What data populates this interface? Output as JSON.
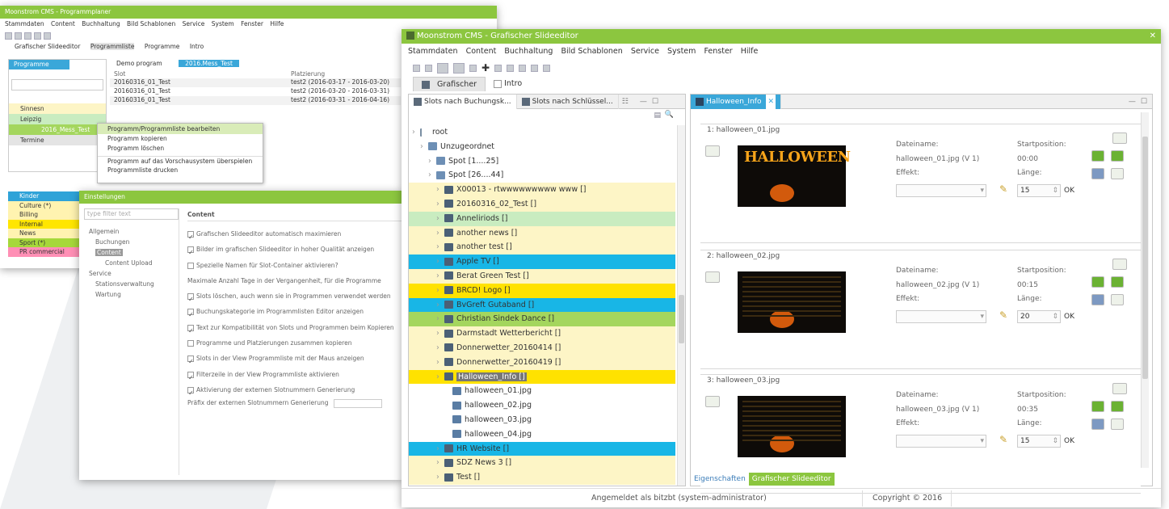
{
  "w1": {
    "title": "Moonstrom CMS - Programmplaner",
    "menu": [
      "Stammdaten",
      "Content",
      "Buchhaltung",
      "Bild Schablonen",
      "Service",
      "System",
      "Fenster",
      "Hilfe"
    ],
    "tabs": [
      "Grafischer Slideeditor",
      "Programmliste",
      "Programme",
      "Intro"
    ],
    "left_tab": "Programme",
    "tree": [
      "Sinnesn",
      "Leipzig",
      "2016_Mess_Test",
      "Termine"
    ],
    "doc_tabs": [
      "Demo program",
      "2016.Mess_Test"
    ],
    "table_headers": [
      "Slot",
      "Platzierung"
    ],
    "table_rows": [
      [
        "20160316_01_Test",
        "test2 (2016-03-17 - 2016-03-20)"
      ],
      [
        "20160316_01_Test",
        "test2 (2016-03-20 - 2016-03-31)"
      ],
      [
        "20160316_01_Test",
        "test2 (2016-03-31 - 2016-04-16)"
      ]
    ],
    "context_menu": [
      "Programm/Programmliste bearbeiten",
      "Programm kopieren",
      "Programm löschen",
      "Programm auf das Vorschausystem überspielen",
      "Programmliste drucken"
    ],
    "categories": [
      {
        "label": "Kinder",
        "color": "#2fa3d8"
      },
      {
        "label": "Culture (*)",
        "color": "#fff3b0"
      },
      {
        "label": "Billing",
        "color": "#fff3b0"
      },
      {
        "label": "Internal",
        "color": "#ffe600"
      },
      {
        "label": "News",
        "color": "#fff3b0"
      },
      {
        "label": "Sport (*)",
        "color": "#a6d83a"
      },
      {
        "label": "PR commercial",
        "color": "#ff8fb5"
      }
    ]
  },
  "w2": {
    "title": "Einstellungen",
    "filter_placeholder": "type filter text",
    "nav": [
      "Allgemein",
      "Buchungen",
      "Content",
      "Content Upload",
      "Service",
      "Stationsverwaltung",
      "Wartung"
    ],
    "heading": "Content",
    "checks": [
      {
        "text": "Grafischen Slideeditor automatisch maximieren",
        "on": true
      },
      {
        "text": "Bilder im grafischen Slideeditor in hoher Qualität anzeigen",
        "on": true
      },
      {
        "text": "Spezielle Namen für Slot-Container aktivieren?",
        "on": false
      },
      {
        "text": "Maximale Anzahl Tage in der Vergangenheit, für die Programme",
        "on": null
      },
      {
        "text": "Slots löschen, auch wenn sie in Programmen verwendet werden",
        "on": true
      },
      {
        "text": "Buchungskategorie im Programmlisten Editor anzeigen",
        "on": true
      },
      {
        "text": "Text zur Kompatibilität von Slots und Programmen beim Kopieren",
        "on": true
      },
      {
        "text": "Programme und Platzierungen zusammen kopieren",
        "on": false
      },
      {
        "text": "Slots in der View Programmliste mit der Maus anzeigen",
        "on": true
      },
      {
        "text": "Filterzeile in der View Programmliste aktivieren",
        "on": true
      },
      {
        "text": "Aktivierung der externen Slotnummern Generierung",
        "on": true
      }
    ],
    "ext_label": "Präfix der externen Slotnummern Generierung"
  },
  "w3": {
    "title": "Moonstrom CMS - Grafischer Slideeditor",
    "menu": [
      "Stammdaten",
      "Content",
      "Buchhaltung",
      "Bild Schablonen",
      "Service",
      "System",
      "Fenster",
      "Hilfe"
    ],
    "tabs": [
      "Grafischer",
      "Intro"
    ],
    "left_tabs": [
      "Slots nach Buchungsk...",
      "Slots nach Schlüssel..."
    ],
    "editor_tab": "Halloween_Info",
    "tree": [
      {
        "text": "root",
        "indent": 0,
        "bg": "",
        "icon": "root"
      },
      {
        "text": "Unzugeordnet",
        "indent": 1,
        "bg": "",
        "icon": "fold"
      },
      {
        "text": "Spot [1....25]",
        "indent": 2,
        "bg": "",
        "icon": "fold"
      },
      {
        "text": "Spot [26....44]",
        "indent": 2,
        "bg": "",
        "icon": "fold"
      },
      {
        "text": "X00013 - rtwwwwwwwww www []",
        "indent": 3,
        "bg": "#fdf5c6",
        "icon": "slot"
      },
      {
        "text": "20160316_02_Test []",
        "indent": 3,
        "bg": "#fdf5c6",
        "icon": "slot"
      },
      {
        "text": "Anneliriods []",
        "indent": 3,
        "bg": "#c9ecc0",
        "icon": "slot"
      },
      {
        "text": "another news []",
        "indent": 3,
        "bg": "#fdf5c6",
        "icon": "slot"
      },
      {
        "text": "another test []",
        "indent": 3,
        "bg": "#fdf5c6",
        "icon": "slot"
      },
      {
        "text": "Apple TV []",
        "indent": 3,
        "bg": "#18b6e6",
        "icon": "slot"
      },
      {
        "text": "Berat Green Test []",
        "indent": 3,
        "bg": "#fdf5c6",
        "icon": "slot"
      },
      {
        "text": "BRCD! Logo []",
        "indent": 3,
        "bg": "#ffe200",
        "icon": "slot"
      },
      {
        "text": "BvGreft Gutaband []",
        "indent": 3,
        "bg": "#18b6e6",
        "icon": "slot"
      },
      {
        "text": "Christian Sindek Dance []",
        "indent": 3,
        "bg": "#a4d65e",
        "icon": "slot"
      },
      {
        "text": "Darmstadt Wetterbericht []",
        "indent": 3,
        "bg": "#fdf5c6",
        "icon": "slot"
      },
      {
        "text": "Donnerwetter_20160414 []",
        "indent": 3,
        "bg": "#fdf5c6",
        "icon": "slot"
      },
      {
        "text": "Donnerwetter_20160419 []",
        "indent": 3,
        "bg": "#fdf5c6",
        "icon": "slot"
      },
      {
        "text": "Halloween_Info []",
        "indent": 3,
        "bg": "#ffe200",
        "icon": "slot",
        "sel": true
      },
      {
        "text": "halloween_01.jpg",
        "indent": 4,
        "bg": "",
        "icon": "img"
      },
      {
        "text": "halloween_02.jpg",
        "indent": 4,
        "bg": "",
        "icon": "img"
      },
      {
        "text": "halloween_03.jpg",
        "indent": 4,
        "bg": "",
        "icon": "img"
      },
      {
        "text": "halloween_04.jpg",
        "indent": 4,
        "bg": "",
        "icon": "img"
      },
      {
        "text": "HR Website []",
        "indent": 3,
        "bg": "#18b6e6",
        "icon": "slot"
      },
      {
        "text": "SDZ News 3 []",
        "indent": 3,
        "bg": "#fdf5c6",
        "icon": "slot"
      },
      {
        "text": "Test []",
        "indent": 3,
        "bg": "#fdf5c6",
        "icon": "slot"
      }
    ],
    "slides": [
      {
        "header": "1: halloween_01.jpg",
        "filename_label": "Dateiname:",
        "filename": "halloween_01.jpg (V 1)",
        "effect_label": "Effekt:",
        "start_label": "Startposition:",
        "start": "00:00",
        "length_label": "Länge:",
        "length": "15",
        "ok": "OK",
        "thumb_text": "HALLOWEEN"
      },
      {
        "header": "2: halloween_02.jpg",
        "filename_label": "Dateiname:",
        "filename": "halloween_02.jpg (V 1)",
        "effect_label": "Effekt:",
        "start_label": "Startposition:",
        "start": "00:15",
        "length_label": "Länge:",
        "length": "20",
        "ok": "OK",
        "thumb_text": ""
      },
      {
        "header": "3: halloween_03.jpg",
        "filename_label": "Dateiname:",
        "filename": "halloween_03.jpg (V 1)",
        "effect_label": "Effekt:",
        "start_label": "Startposition:",
        "start": "00:35",
        "length_label": "Länge:",
        "length": "15",
        "ok": "OK",
        "thumb_text": ""
      }
    ],
    "bottom_tabs": [
      "Eigenschaften",
      "Grafischer Slideeditor"
    ],
    "status_login": "Angemeldet als bitzbt (system-administrator)",
    "status_copyright": "Copyright © 2016"
  }
}
